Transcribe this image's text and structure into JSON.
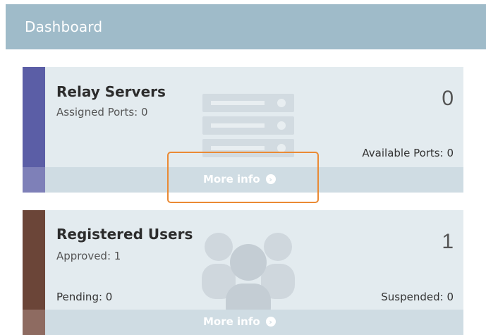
{
  "header": {
    "title": "Dashboard"
  },
  "relay_card": {
    "title": "Relay Servers",
    "assigned": "Assigned Ports: 0",
    "count": "0",
    "available": "Available Ports: 0",
    "more_info": "More info",
    "accent": "#5b5ea6"
  },
  "users_card": {
    "title": "Registered Users",
    "approved": "Approved: 1",
    "count": "1",
    "pending": "Pending: 0",
    "suspended": "Suspended: 0",
    "more_info": "More info",
    "accent": "#6b4538"
  },
  "colors": {
    "highlight": "#ea8a34",
    "header": "#9fbbc9",
    "card_bg": "#e3ebef"
  }
}
